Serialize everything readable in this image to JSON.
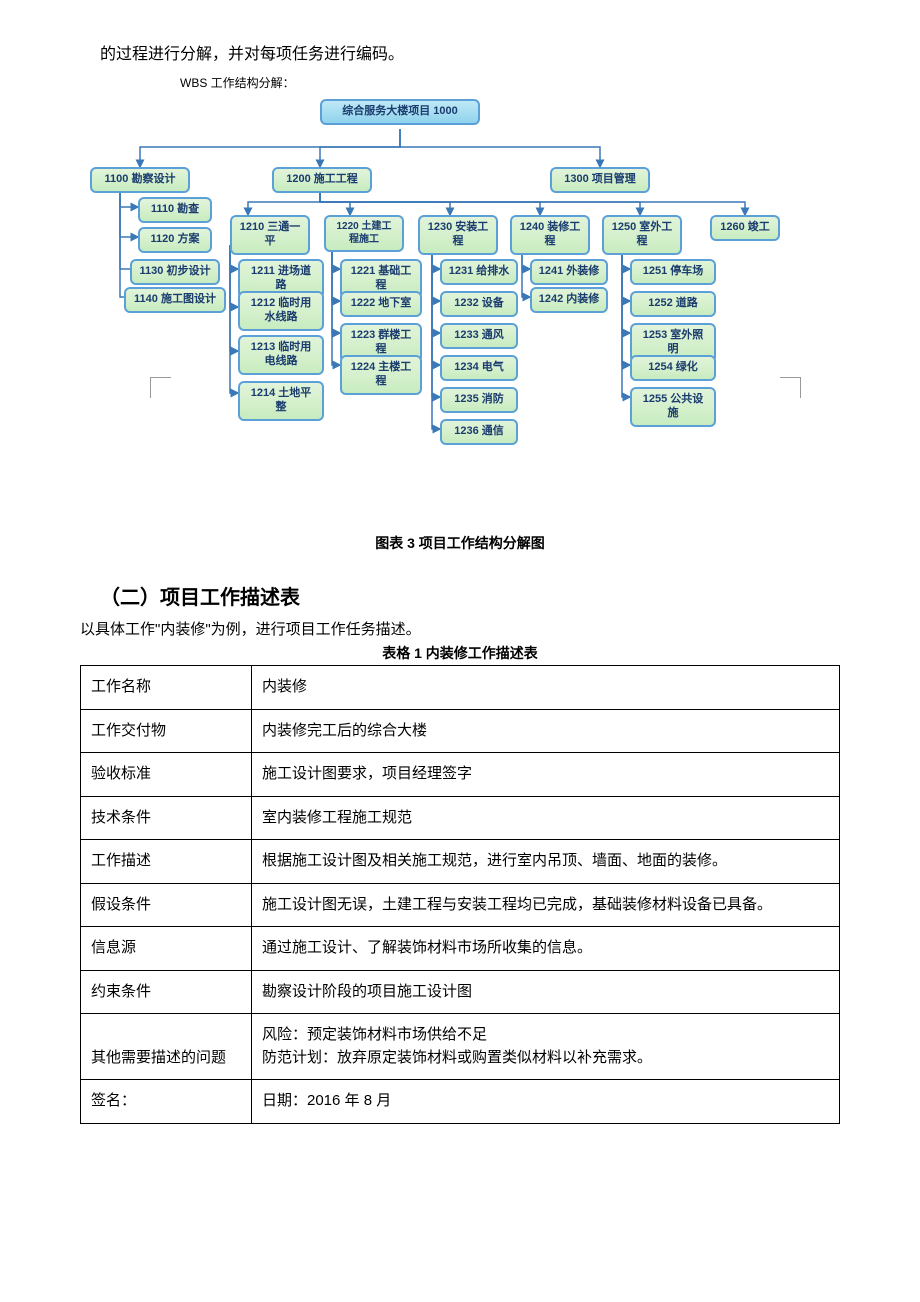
{
  "intro": "的过程进行分解，并对每项任务进行编码。",
  "wbsLabel": "WBS 工作结构分解：",
  "root": "综合服务大楼项目 1000",
  "level2": {
    "a": "1100 勘察设计",
    "b": "1200 施工工程",
    "c": "1300 项目管理"
  },
  "col1100": [
    "1110 勘查",
    "1120 方案",
    "1130 初步设计",
    "1140 施工图设计"
  ],
  "row1200": {
    "1210": "1210 三通一平",
    "1220": "1220 土建工程施工",
    "1230": "1230 安装工程",
    "1240": "1240 装修工程",
    "1250": "1250 室外工程",
    "1260": "1260 竣工"
  },
  "col1210": [
    "1211 进场道路",
    "1212 临时用水线路",
    "1213 临时用电线路",
    "1214 土地平整"
  ],
  "col1220": [
    "1221 基础工程",
    "1222 地下室",
    "1223 群楼工程",
    "1224 主楼工程"
  ],
  "col1230": [
    "1231 给排水",
    "1232 设备",
    "1233 通风",
    "1234 电气",
    "1235 消防",
    "1236 通信"
  ],
  "col1240": [
    "1241 外装修",
    "1242 内装修"
  ],
  "col1250": [
    "1251 停车场",
    "1252 道路",
    "1253 室外照明",
    "1254 绿化",
    "1255 公共设施"
  ],
  "figureCaption": "图表 3 项目工作结构分解图",
  "sectionHeading": "（二）项目工作描述表",
  "subtext": "以具体工作\"内装修\"为例，进行项目工作任务描述。",
  "tableCaption": "表格 1 内装修工作描述表",
  "table": {
    "r1l": "工作名称",
    "r1v": "内装修",
    "r2l": "工作交付物",
    "r2v": "内装修完工后的综合大楼",
    "r3l": "验收标准",
    "r3v": "施工设计图要求，项目经理签字",
    "r4l": "技术条件",
    "r4v": "室内装修工程施工规范",
    "r5l": "工作描述",
    "r5v": "根据施工设计图及相关施工规范，进行室内吊顶、墙面、地面的装修。",
    "r6l": "假设条件",
    "r6v": "施工设计图无误，土建工程与安装工程均已完成，基础装修材料设备已具备。",
    "r7l": "信息源",
    "r7v": "通过施工设计、了解装饰材料市场所收集的信息。",
    "r8l": "约束条件",
    "r8v": "勘察设计阶段的项目施工设计图",
    "r9l": "其他需要描述的问题",
    "r9v": "风险：预定装饰材料市场供给不足\n 防范计划：放弃原定装饰材料或购置类似材料以补充需求。",
    "r10l": "签名：",
    "r10v": "日期：2016 年 8 月"
  }
}
